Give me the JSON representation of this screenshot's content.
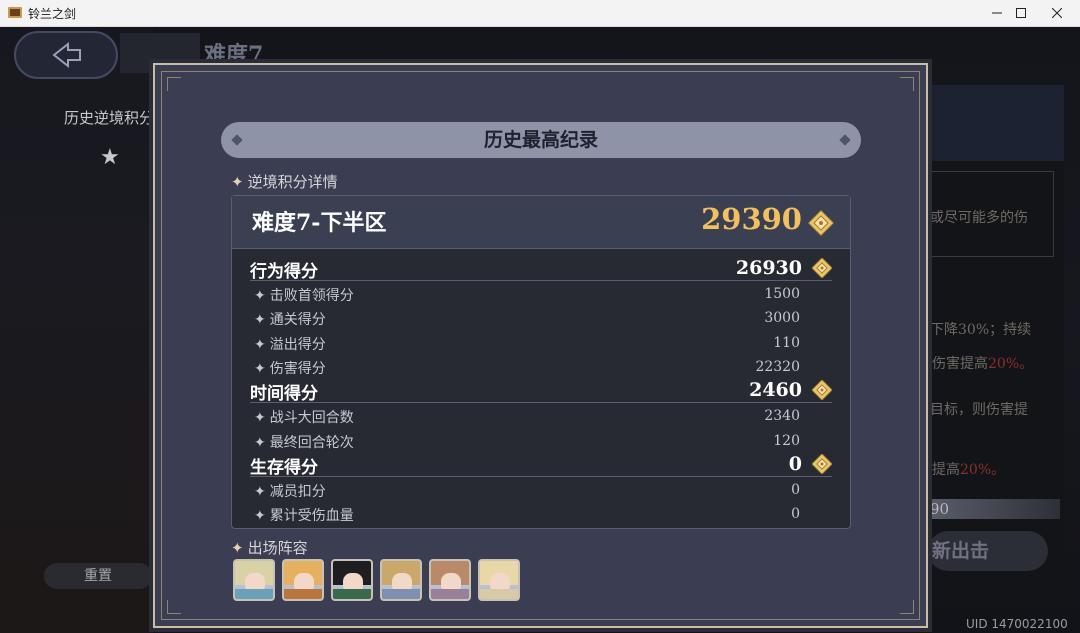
{
  "window": {
    "title": "铃兰之剑"
  },
  "background": {
    "difficulty_title": "难度7",
    "history_label": "历史逆境积分",
    "reset_label": "重置",
    "right_snippets": {
      "line1": "或尽可能多的伤",
      "line2": "下降30%；持续",
      "line3a": "伤害提高",
      "line3b": "20%。",
      "line4": "目标，则伤害提",
      "line5a": "提高",
      "line5b": "20%。"
    },
    "score_partial": "90",
    "new_battle_label": "新出击",
    "uid": "UID 1470022100"
  },
  "modal": {
    "title": "历史最高纪录",
    "details_label": "逆境积分详情",
    "header": {
      "title": "难度7-下半区",
      "total": "29390"
    },
    "categories": [
      {
        "label": "行为得分",
        "value": "26930",
        "items": [
          {
            "label": "击败首领得分",
            "value": "1500"
          },
          {
            "label": "通关得分",
            "value": "3000"
          },
          {
            "label": "溢出得分",
            "value": "110"
          },
          {
            "label": "伤害得分",
            "value": "22320"
          }
        ]
      },
      {
        "label": "时间得分",
        "value": "2460",
        "items": [
          {
            "label": "战斗大回合数",
            "value": "2340"
          },
          {
            "label": "最终回合轮次",
            "value": "120"
          }
        ]
      },
      {
        "label": "生存得分",
        "value": "0",
        "items": [
          {
            "label": "减员扣分",
            "value": "0"
          },
          {
            "label": "累计受伤血量",
            "value": "0"
          }
        ]
      }
    ],
    "lineup_label": "出场阵容",
    "lineup": [
      {
        "hair": "#d9d2a6",
        "cloth": "#6aa0b8"
      },
      {
        "hair": "#e6b060",
        "cloth": "#b8763e"
      },
      {
        "hair": "#1e1e22",
        "cloth": "#3a6a4e"
      },
      {
        "hair": "#c9a86a",
        "cloth": "#7f8fb0"
      },
      {
        "hair": "#b88a6a",
        "cloth": "#9a7f9a"
      },
      {
        "hair": "#ead7a8",
        "cloth": "#d8c9a8"
      }
    ]
  },
  "colors": {
    "accent_gold": "#f2c05e",
    "frame": "#c9bda3",
    "panel": "#3b3e52"
  }
}
